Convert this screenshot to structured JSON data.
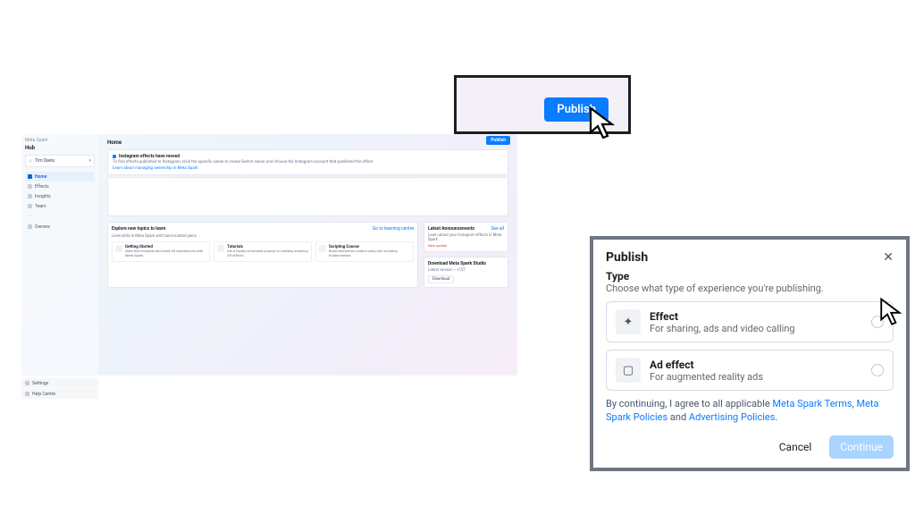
{
  "hub": {
    "brand": "Meta Spark",
    "title": "Hub",
    "owner_label": "Tim Davis",
    "nav": {
      "home": "Home",
      "effects": "Effects",
      "insights": "Insights",
      "team": "Team",
      "owners": "Owners"
    },
    "footer_nav": {
      "settings": "Settings",
      "help": "Help Centre"
    },
    "page_title": "Home",
    "publish_small": "Publish",
    "notice": {
      "title": "Instagram effects have moved",
      "desc": "To find effects published to Instagram, click the specific owner to reveal Switch owner and choose the Instagram account that published the effect.",
      "link": "Learn about managing ownership in Meta Spark"
    },
    "explore": {
      "title": "Explore new topics to learn",
      "sub": "Level skills in Meta Spark with hand-curated plans",
      "link": "Go to learning centre",
      "tiles": [
        {
          "title": "Getting Started",
          "desc": "Start this template and build AR experiences with Meta Spark"
        },
        {
          "title": "Tutorials",
          "desc": "Get a hands-on tutorial journey to creating amazing AR effects"
        },
        {
          "title": "Scripting Course",
          "desc": "Build interactive content using the scripting fundamentals"
        }
      ]
    },
    "announce": {
      "title": "Latest Announcements",
      "see_all": "See all",
      "item_desc": "Learn about your Instagram effects in Meta Spark",
      "item_tag": "New update"
    },
    "download": {
      "title": "Download Meta Spark Studio",
      "version": "Latest version — v157",
      "btn": "Download"
    }
  },
  "callout": {
    "publish": "Publish"
  },
  "modal": {
    "title": "Publish",
    "type_label": "Type",
    "type_sub": "Choose what type of experience you're publishing.",
    "options": [
      {
        "icon": "✦",
        "title": "Effect",
        "desc": "For sharing, ads and video calling"
      },
      {
        "icon": "▢",
        "title": "Ad effect",
        "desc": "For augmented reality ads"
      }
    ],
    "legal_prefix": "By continuing, I agree to all applicable ",
    "legal_link1": "Meta Spark Terms",
    "legal_sep1": ", ",
    "legal_link2": "Meta Spark Policies",
    "legal_sep2": " and ",
    "legal_link3": "Advertising Policies",
    "legal_suffix": ".",
    "cancel": "Cancel",
    "continue": "Continue"
  }
}
